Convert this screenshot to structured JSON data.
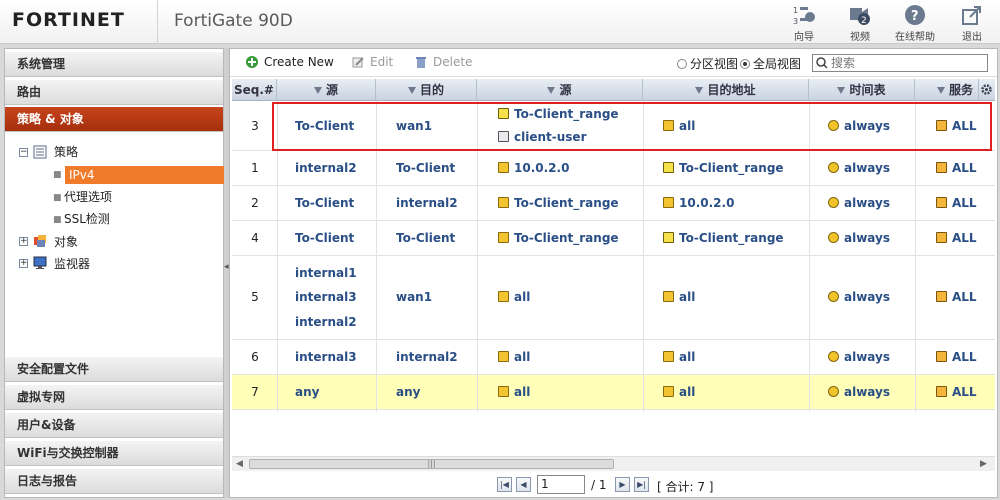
{
  "header": {
    "logo": "FORTINET",
    "product": "FortiGate 90D",
    "buttons": [
      {
        "label": "向导",
        "icon": "wizard-icon"
      },
      {
        "label": "视频",
        "icon": "video-icon"
      },
      {
        "label": "在线帮助",
        "icon": "help-icon"
      },
      {
        "label": "退出",
        "icon": "logout-icon"
      }
    ]
  },
  "sidebar": {
    "top_items": [
      "系统管理",
      "路由",
      "策略 & 对象"
    ],
    "tree": {
      "policy": "策略",
      "ipv4": "IPv4",
      "proxy": "代理选项",
      "ssl": "SSL检测",
      "objects": "对象",
      "monitor": "监视器"
    },
    "bottom_items": [
      "安全配置文件",
      "虚拟专网",
      "用户&设备",
      "WiFi与交换控制器",
      "日志与报告"
    ]
  },
  "toolbar": {
    "create": "Create New",
    "edit": "Edit",
    "delete": "Delete",
    "section_view": "分区视图",
    "global_view": "全局视图",
    "search_placeholder": "搜索"
  },
  "columns": [
    "Seq.#",
    "源",
    "目的",
    "源",
    "目的地址",
    "时间表",
    "服务"
  ],
  "rows": [
    {
      "seq": "3",
      "src_if": [
        "To-Client"
      ],
      "dst_if": [
        "wan1"
      ],
      "src": [
        {
          "t": "range",
          "v": "To-Client_range"
        },
        {
          "t": "user",
          "v": "client-user"
        }
      ],
      "dst": [
        {
          "t": "addr",
          "v": "all"
        }
      ],
      "sched": "always",
      "svc": "ALL"
    },
    {
      "seq": "1",
      "src_if": [
        "internal2"
      ],
      "dst_if": [
        "To-Client"
      ],
      "src": [
        {
          "t": "addr",
          "v": "10.0.2.0"
        }
      ],
      "dst": [
        {
          "t": "range",
          "v": "To-Client_range"
        }
      ],
      "sched": "always",
      "svc": "ALL"
    },
    {
      "seq": "2",
      "src_if": [
        "To-Client"
      ],
      "dst_if": [
        "internal2"
      ],
      "src": [
        {
          "t": "addr",
          "v": "To-Client_range"
        }
      ],
      "dst": [
        {
          "t": "addr",
          "v": "10.0.2.0"
        }
      ],
      "sched": "always",
      "svc": "ALL"
    },
    {
      "seq": "4",
      "src_if": [
        "To-Client"
      ],
      "dst_if": [
        "To-Client"
      ],
      "src": [
        {
          "t": "addr",
          "v": "To-Client_range"
        }
      ],
      "dst": [
        {
          "t": "range",
          "v": "To-Client_range"
        }
      ],
      "sched": "always",
      "svc": "ALL"
    },
    {
      "seq": "5",
      "src_if": [
        "internal1",
        "internal3",
        "internal2"
      ],
      "dst_if": [
        "wan1"
      ],
      "src": [
        {
          "t": "addr",
          "v": "all"
        }
      ],
      "dst": [
        {
          "t": "addr",
          "v": "all"
        }
      ],
      "sched": "always",
      "svc": "ALL"
    },
    {
      "seq": "6",
      "src_if": [
        "internal3"
      ],
      "dst_if": [
        "internal2"
      ],
      "src": [
        {
          "t": "addr",
          "v": "all"
        }
      ],
      "dst": [
        {
          "t": "addr",
          "v": "all"
        }
      ],
      "sched": "always",
      "svc": "ALL"
    },
    {
      "seq": "7",
      "src_if": [
        "any"
      ],
      "dst_if": [
        "any"
      ],
      "src": [
        {
          "t": "addr",
          "v": "all"
        }
      ],
      "dst": [
        {
          "t": "addr",
          "v": "all"
        }
      ],
      "sched": "always",
      "svc": "ALL"
    }
  ],
  "pager": {
    "page": "1",
    "of": "/ 1",
    "total": "[ 合计: 7 ]"
  }
}
